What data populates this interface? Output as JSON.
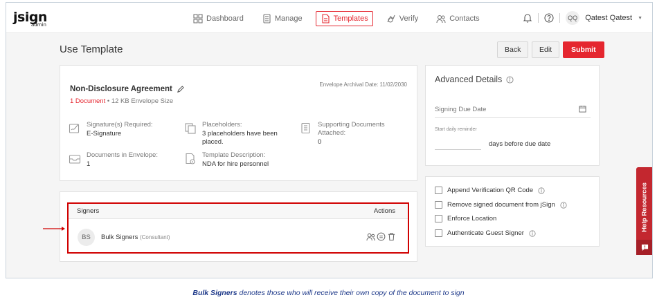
{
  "app": {
    "logo": "jsign",
    "logo_sub": "admin"
  },
  "nav": {
    "items": [
      {
        "label": "Dashboard",
        "icon": "dashboard-icon"
      },
      {
        "label": "Manage",
        "icon": "manage-icon"
      },
      {
        "label": "Templates",
        "icon": "templates-icon",
        "active": true
      },
      {
        "label": "Verify",
        "icon": "verify-icon"
      },
      {
        "label": "Contacts",
        "icon": "contacts-icon"
      }
    ],
    "user_initials": "QQ",
    "user_name": "Qatest Qatest"
  },
  "page": {
    "title": "Use Template",
    "back_label": "Back",
    "edit_label": "Edit",
    "submit_label": "Submit"
  },
  "document": {
    "name": "Non-Disclosure Agreement",
    "archival": "Envelope Archival Date: 11/02/2030",
    "count_link": "1 Document",
    "size_text": "12 KB Envelope Size",
    "signatures_label": "Signature(s) Required:",
    "signatures_value": "E-Signature",
    "placeholders_label": "Placeholders:",
    "placeholders_value": "3 placeholders have been placed.",
    "supporting_label": "Supporting Documents Attached:",
    "supporting_value": "0",
    "docs_label": "Documents in Envelope:",
    "docs_value": "1",
    "template_desc_label": "Template Description:",
    "template_desc_value": "NDA for hire personnel"
  },
  "signers": {
    "header": "Signers",
    "actions_header": "Actions",
    "rows": [
      {
        "initials": "BS",
        "name": "Bulk Signers",
        "role": "(Consultant)"
      }
    ]
  },
  "advanced": {
    "title": "Advanced Details",
    "due_placeholder": "Signing Due Date",
    "reminder_label": "Start daily reminder",
    "reminder_suffix": "days before due date"
  },
  "options": [
    {
      "label": "Append Verification QR Code",
      "checked": false
    },
    {
      "label": "Remove signed document from jSign",
      "checked": false
    },
    {
      "label": "Enforce Location",
      "checked": false
    },
    {
      "label": "Authenticate Guest Signer",
      "checked": false
    }
  ],
  "help": {
    "label": "Help Resources"
  },
  "caption": {
    "bold": "Bulk Signers",
    "rest": " denotes those who will receive their own copy of the document to sign"
  },
  "colors": {
    "accent": "#e5262f",
    "highlight_border": "#d00000",
    "caption": "#1f3a8a"
  }
}
